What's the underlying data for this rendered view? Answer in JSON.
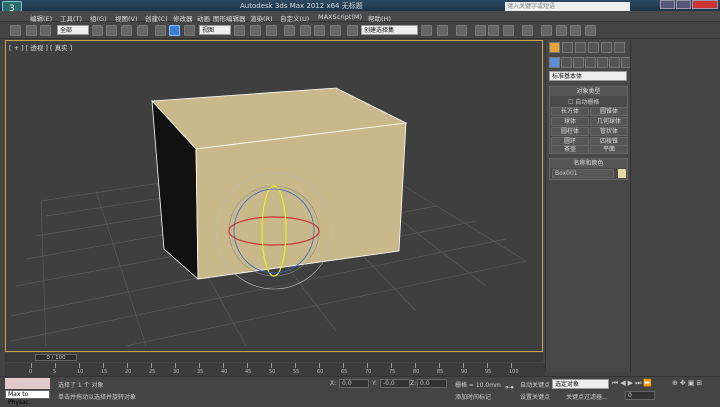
{
  "app": {
    "title": "Autodesk 3ds Max 2012 x64    无标题",
    "search_placeholder": "键入关键字或短语",
    "logo": "3"
  },
  "menu": [
    "编辑(E)",
    "工具(T)",
    "组(G)",
    "视图(V)",
    "创建(C)",
    "修改器",
    "动画",
    "图形编辑器",
    "渲染(R)",
    "自定义(U)",
    "MAXScript(M)",
    "帮助(H)"
  ],
  "toolbar": {
    "selection_filter": "全部",
    "ref_coord": "视图",
    "named_selection": "创建选择集"
  },
  "viewport": {
    "label": "[ + ] [ 透视 ] [ 真实 ]",
    "box_color": "#c9b98a"
  },
  "command_panel": {
    "category": "标准基本体",
    "object_type_title": "对象类型",
    "autogrid": "自动栅格",
    "buttons": [
      "长方体",
      "圆锥体",
      "球体",
      "几何球体",
      "圆柱体",
      "管状体",
      "圆环",
      "四棱锥",
      "茶壶",
      "平面"
    ],
    "name_color_title": "名称和颜色",
    "object_name": "Box001",
    "object_color": "#e8d9a0"
  },
  "timeline": {
    "position": "0 / 100",
    "ticks": [
      "0",
      "5",
      "10",
      "15",
      "20",
      "25",
      "30",
      "35",
      "40",
      "45",
      "50",
      "55",
      "60",
      "65",
      "70",
      "75",
      "80",
      "85",
      "90",
      "95",
      "100"
    ]
  },
  "status": {
    "maxscript": "Max to Physac",
    "selected": "选择了 1 个 对象",
    "prompt": "单击并拖动以选择并旋转对象",
    "x_label": "X:",
    "x": "0.0",
    "y_label": "Y:",
    "y": "-0.0",
    "z_label": "Z:",
    "z": "0.0",
    "grid": "栅格 = 10.0mm",
    "add_time_tag": "添加时间标记",
    "auto_key": "自动关键点",
    "selected_obj": "选定对象",
    "set_key": "设置关键点",
    "key_filters": "关键点过滤器...",
    "frame": "0"
  }
}
